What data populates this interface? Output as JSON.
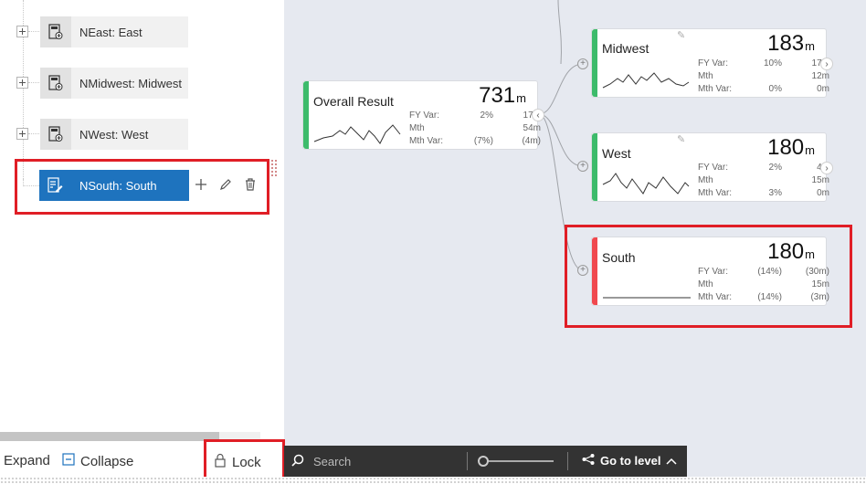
{
  "tree": {
    "nodes": [
      {
        "label": "NEast: East"
      },
      {
        "label": "NMidwest: Midwest"
      },
      {
        "label": "NWest: West"
      }
    ],
    "selected": {
      "label": "NSouth: South"
    }
  },
  "root": {
    "title": "Overall Result",
    "value": "731",
    "unit": "m",
    "metrics": [
      {
        "label": "FY Var:",
        "var": "2%",
        "val": "17m"
      },
      {
        "label": "Mth",
        "var": "",
        "val": "54m"
      },
      {
        "label": "Mth Var:",
        "var": "(7%)",
        "val": "(4m)"
      }
    ],
    "stripe_color": "#3dbb6b"
  },
  "children": [
    {
      "title": "Midwest",
      "value": "183",
      "unit": "m",
      "metrics": [
        {
          "label": "FY Var:",
          "var": "10%",
          "val": "17m"
        },
        {
          "label": "Mth",
          "var": "",
          "val": "12m"
        },
        {
          "label": "Mth Var:",
          "var": "0%",
          "val": "0m"
        }
      ],
      "stripe_color": "#3dbb6b"
    },
    {
      "title": "West",
      "value": "180",
      "unit": "m",
      "metrics": [
        {
          "label": "FY Var:",
          "var": "2%",
          "val": "4m"
        },
        {
          "label": "Mth",
          "var": "",
          "val": "15m"
        },
        {
          "label": "Mth Var:",
          "var": "3%",
          "val": "0m"
        }
      ],
      "stripe_color": "#3dbb6b"
    },
    {
      "title": "South",
      "value": "180",
      "unit": "m",
      "metrics": [
        {
          "label": "FY Var:",
          "var": "(14%)",
          "val": "(30m)"
        },
        {
          "label": "Mth",
          "var": "",
          "val": "15m"
        },
        {
          "label": "Mth Var:",
          "var": "(14%)",
          "val": "(3m)"
        }
      ],
      "stripe_color": "#f0484e"
    }
  ],
  "bottom": {
    "expand_label": "Expand",
    "collapse_label": "Collapse",
    "lock_label": "Lock",
    "search_placeholder": "Search",
    "goto_label": "Go to level"
  },
  "colors": {
    "selected_node": "#1e73be",
    "highlight": "#e01e26",
    "positive_stripe": "#3dbb6b",
    "negative_stripe": "#f0484e",
    "toolbar": "#333333"
  }
}
